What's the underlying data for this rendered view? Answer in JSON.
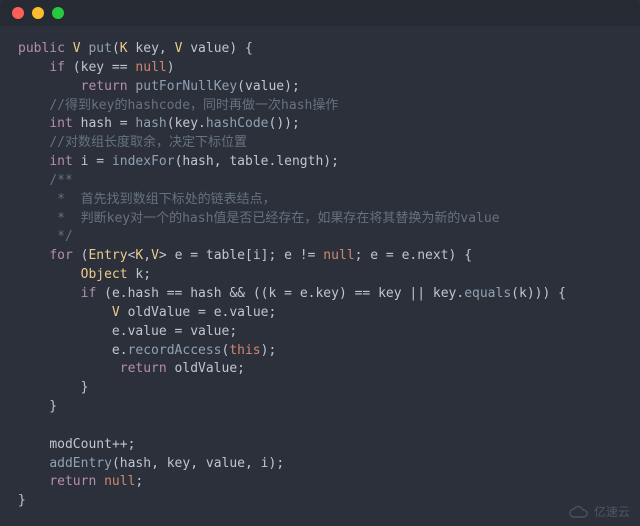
{
  "code": {
    "l1": {
      "kw0": "public",
      "ty0": "V",
      "fn0": "put",
      "ty1": "K",
      "id0": "key",
      "ty2": "V",
      "id1": "value"
    },
    "l2": {
      "kw0": "if",
      "id0": "key",
      "nl": "null"
    },
    "l3": {
      "kw0": "return",
      "fn0": "putForNullKey",
      "id0": "value"
    },
    "l4": {
      "cm": "//得到key的hashcode，同时再做一次hash操作"
    },
    "l5": {
      "kw0": "int",
      "id0": "hash",
      "fn0": "hash",
      "id1": "key",
      "fn1": "hashCode"
    },
    "l6": {
      "cm": "//对数组长度取余，决定下标位置"
    },
    "l7": {
      "kw0": "int",
      "id0": "i",
      "fn0": "indexFor",
      "id1": "hash",
      "id2": "table",
      "id3": "length"
    },
    "l8": {
      "cm": "/**"
    },
    "l9": {
      "cm": " *  首先找到数组下标处的链表结点，"
    },
    "l10": {
      "cm": " *  判断key对一个的hash值是否已经存在，如果存在将其替换为新的value"
    },
    "l11": {
      "cm": " */"
    },
    "l12": {
      "kw0": "for",
      "ty0": "Entry",
      "ty1": "K",
      "ty2": "V",
      "id0": "e",
      "id1": "table",
      "id2": "i",
      "id3": "e",
      "nl": "null",
      "id4": "e",
      "id5": "e",
      "id6": "next"
    },
    "l13": {
      "ty0": "Object",
      "id0": "k"
    },
    "l14": {
      "kw0": "if",
      "id0": "e",
      "id1": "hash",
      "id2": "hash",
      "id3": "k",
      "id4": "e",
      "id5": "key",
      "id6": "key",
      "id7": "key",
      "fn0": "equals",
      "id8": "k"
    },
    "l15": {
      "ty0": "V",
      "id0": "oldValue",
      "id1": "e",
      "id2": "value"
    },
    "l16": {
      "id0": "e",
      "id1": "value",
      "id2": "value"
    },
    "l17": {
      "id0": "e",
      "fn0": "recordAccess",
      "th": "this"
    },
    "l18": {
      "kw0": "return",
      "id0": "oldValue"
    },
    "l23": {
      "id0": "modCount"
    },
    "l24": {
      "fn0": "addEntry",
      "id0": "hash",
      "id1": "key",
      "id2": "value",
      "id3": "i"
    },
    "l25": {
      "kw0": "return",
      "nl": "null"
    }
  },
  "watermark": "亿速云"
}
